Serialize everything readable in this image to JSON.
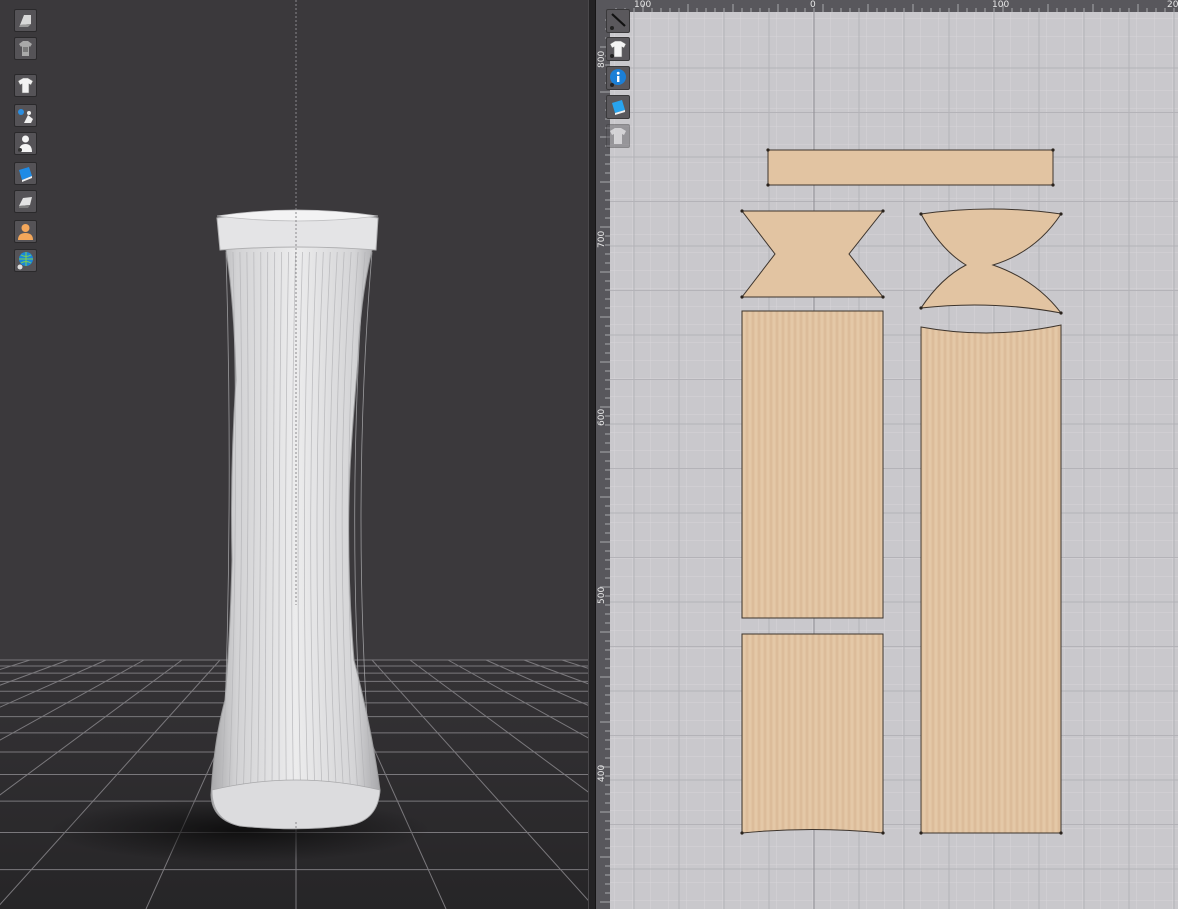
{
  "viewport_3d": {
    "toolbar": [
      {
        "name": "avatar-display-icon"
      },
      {
        "name": "garment-display-icon"
      },
      {
        "name": "garment-shirt-icon"
      },
      {
        "name": "avatar-pose-icon"
      },
      {
        "name": "avatar-body-icon"
      },
      {
        "name": "texture-view-icon"
      },
      {
        "name": "shading-view-icon"
      },
      {
        "name": "avatar-skin-icon"
      },
      {
        "name": "environment-globe-icon"
      }
    ]
  },
  "pattern_2d": {
    "ruler_top": [
      "100",
      "0",
      "100",
      "20"
    ],
    "ruler_left": [
      "800",
      "700",
      "600",
      "500",
      "400"
    ],
    "toolbar": [
      {
        "name": "pattern-edit-icon"
      },
      {
        "name": "shirt-view-icon"
      },
      {
        "name": "info-icon"
      },
      {
        "name": "texture-icon"
      },
      {
        "name": "garment-ghost-icon"
      }
    ],
    "pattern_pieces": [
      "cuff-band",
      "heel-left",
      "heel-right",
      "leg-left-upper",
      "leg-left-lower",
      "leg-right"
    ],
    "colors": {
      "fabric": "#e2c4a2",
      "fabric_stroke": "#3d342c",
      "grid_bg": "#c9c8cc",
      "viewport_bg": "#3b393c"
    }
  }
}
